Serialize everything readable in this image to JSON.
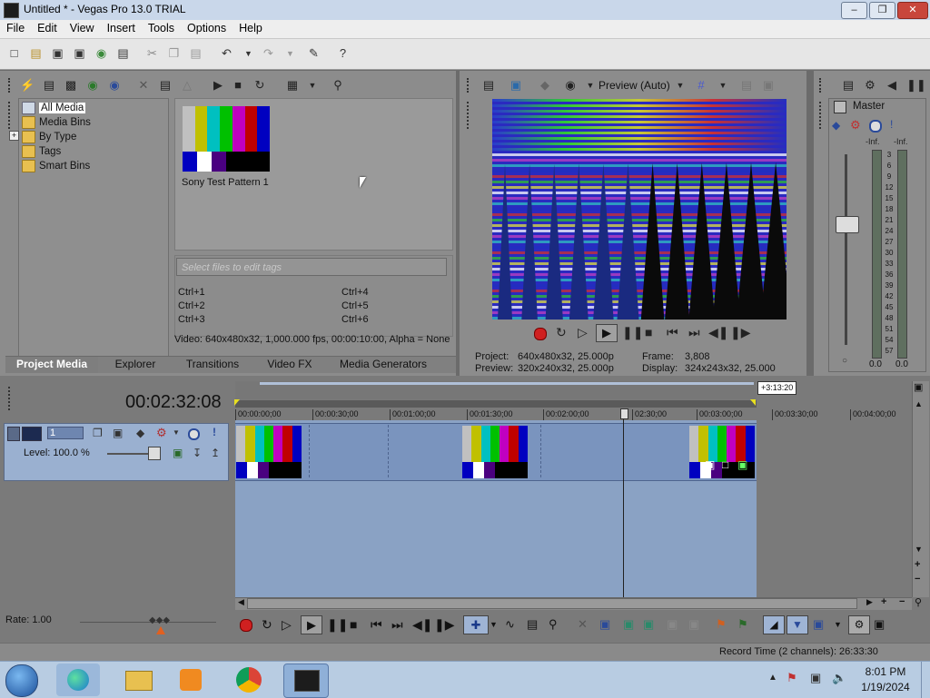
{
  "window": {
    "title": "Untitled * - Vegas Pro 13.0 TRIAL",
    "minimize_glyph": "–",
    "maximize_glyph": "❐",
    "close_glyph": "✕"
  },
  "menu": [
    "File",
    "Edit",
    "View",
    "Insert",
    "Tools",
    "Options",
    "Help"
  ],
  "media_tree": {
    "items": [
      "All Media",
      "Media Bins",
      "By Type",
      "Tags",
      "Smart Bins"
    ],
    "expander": "+"
  },
  "media_list": {
    "items": [
      {
        "label": "Sony Test Pattern 1"
      }
    ]
  },
  "tags": {
    "placeholder": "Select files to edit tags",
    "shortcuts": [
      "Ctrl+1",
      "Ctrl+4",
      "Ctrl+2",
      "Ctrl+5",
      "Ctrl+3",
      "Ctrl+6"
    ]
  },
  "media_info": "Video: 640x480x32, 1,000.000 fps, 00:00:10:00, Alpha = None",
  "tabs": [
    "Project Media",
    "Explorer",
    "Transitions",
    "Video FX",
    "Media Generators"
  ],
  "preview": {
    "mode": "Preview (Auto)",
    "project_label": "Project:",
    "project_value": "640x480x32, 25.000p",
    "preview_label": "Preview:",
    "preview_value": "320x240x32, 25.000p",
    "frame_label": "Frame:",
    "frame_value": "3,808",
    "display_label": "Display:",
    "display_value": "324x243x32, 25.000"
  },
  "mixer": {
    "title": "Master",
    "peak_left": "-Inf.",
    "peak_right": "-Inf.",
    "scale": [
      "3",
      "6",
      "9",
      "12",
      "15",
      "18",
      "21",
      "24",
      "27",
      "30",
      "33",
      "36",
      "39",
      "42",
      "45",
      "48",
      "51",
      "54",
      "57"
    ],
    "bottom_left": "0.0",
    "bottom_right": "0.0"
  },
  "timeline": {
    "timecode": "00:02:32:08",
    "end_marker": "+3:13:20",
    "ruler": [
      "00:00:00;00",
      "00:00:30;00",
      "00:01:00;00",
      "00:01:30;00",
      "00:02:00;00",
      "02:30;00",
      "00:03:00;00",
      "00:03:30;00",
      "00:04:00;00"
    ],
    "track_number": "1",
    "level": "Level: 100.0 %",
    "rate": "Rate: 1.00"
  },
  "status": {
    "record_time": "Record Time (2 channels): 26:33:30"
  },
  "taskbar": {
    "time": "8:01 PM",
    "date": "1/19/2024"
  },
  "colors": {
    "test_pattern": [
      "#c0c0c0",
      "#c0c000",
      "#00c0c0",
      "#00c000",
      "#c000c0",
      "#c00000",
      "#0000c0"
    ],
    "test_pattern_bottom": [
      "#0000c0",
      "#ffffff",
      "#4a0080",
      "#000000",
      "#000000",
      "#000000"
    ],
    "timeline_bg": "#8aa2c4",
    "record_red": "#d02020"
  }
}
